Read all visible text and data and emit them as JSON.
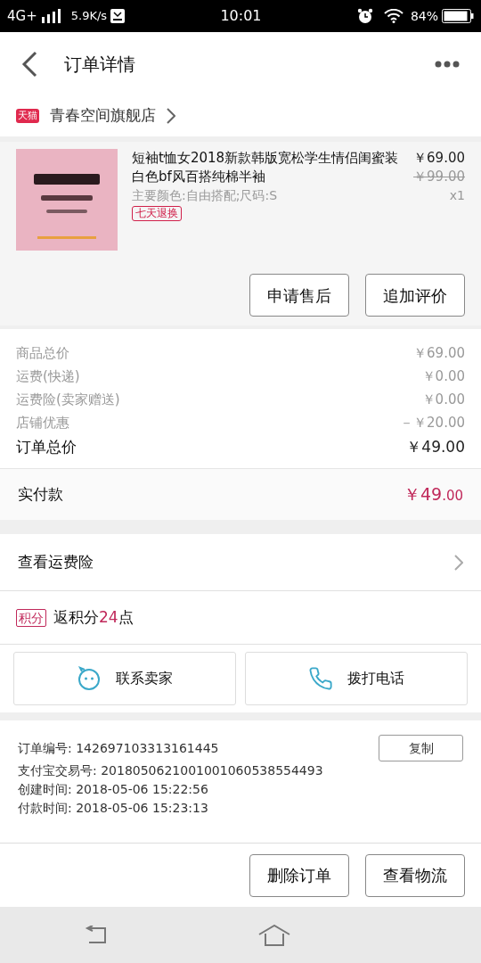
{
  "status_bar": {
    "network": "4G+",
    "speed": "5.9K/s",
    "time": "10:01",
    "battery": "84%"
  },
  "header": {
    "title": "订单详情"
  },
  "shop": {
    "badge": "天猫",
    "name": "青春空间旗舰店"
  },
  "product": {
    "title": "短袖t恤女2018新款韩版宽松学生情侣闺蜜装白色bf风百搭纯棉半袖",
    "spec": "主要颜色:自由搭配;尺码:S",
    "tag": "七天退换",
    "price": "￥69.00",
    "original_price": "￥99.00",
    "quantity": "x1",
    "actions": [
      "申请售后",
      "追加评价"
    ]
  },
  "summary": [
    {
      "label": "商品总价",
      "value": "￥69.00",
      "kind": "line"
    },
    {
      "label": "运费(快递)",
      "value": "￥0.00",
      "kind": "line"
    },
    {
      "label": "运费险(卖家赠送)",
      "value": "￥0.00",
      "kind": "line"
    },
    {
      "label": "店铺优惠",
      "value": "－￥20.00",
      "kind": "line"
    },
    {
      "label": "订单总价",
      "value": "￥49.00",
      "kind": "total"
    }
  ],
  "paid": {
    "label": "实付款",
    "amount": "￥49",
    "cents": ".00"
  },
  "insurance": {
    "label": "查看运费险"
  },
  "points": {
    "badge": "积分",
    "prefix": "返积分",
    "value": "24",
    "suffix": "点"
  },
  "contact": [
    {
      "label": "联系卖家",
      "kind": "chat"
    },
    {
      "label": "拨打电话",
      "kind": "phone"
    }
  ],
  "details": [
    {
      "text": "订单编号: 142697103313161445",
      "copy": "复制"
    },
    {
      "text": "支付宝交易号: 2018050621001001060538554493"
    },
    {
      "text": "创建时间: 2018-05-06 15:22:56"
    },
    {
      "text": "付款时间: 2018-05-06 15:23:13"
    }
  ],
  "footer_buttons": [
    "删除订单",
    "查看物流"
  ]
}
